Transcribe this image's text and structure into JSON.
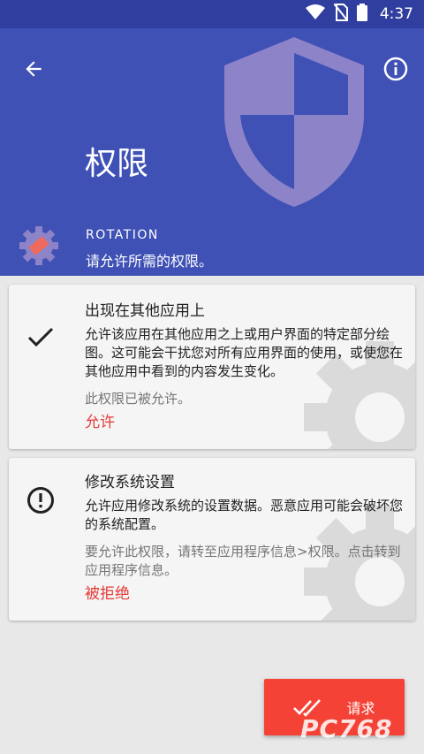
{
  "status_bar": {
    "time": "4:37"
  },
  "header": {
    "title": "权限",
    "app_name": "ROTATION",
    "subtitle": "请允许所需的权限。"
  },
  "permissions": [
    {
      "title": "出现在其他应用上",
      "description": "允许该应用在其他应用之上或用户界面的特定部分绘图。这可能会干扰您对所有应用界面的使用，或使您在其他应用中看到的内容发生变化。",
      "note": "此权限已被允许。",
      "action": "允许",
      "icon": "check-icon"
    },
    {
      "title": "修改系统设置",
      "description": "允许应用修改系统的设置数据。恶意应用可能会破坏您的系统配置。",
      "note": "要允许此权限，请转至应用程序信息>权限。点击转到应用程序信息。",
      "action": "被拒绝",
      "icon": "alert-icon"
    }
  ],
  "request_button": {
    "label": "请求"
  },
  "watermark": {
    "logo": "PC768"
  },
  "colors": {
    "primary": "#3f51b5",
    "primary_dark": "#303f9f",
    "accent": "#f44336",
    "action_red": "#e53935",
    "background": "#e8e8e8"
  }
}
